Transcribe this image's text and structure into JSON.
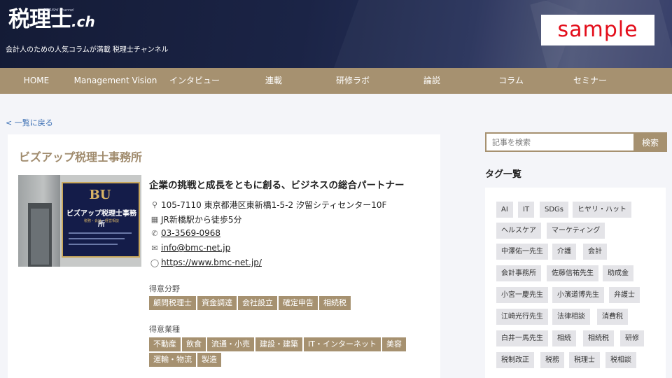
{
  "header": {
    "logo_main": "税理士",
    "logo_ch": ".ch",
    "logo_small": "ZEIRISHI Channel",
    "tagline": "会計人のための人気コラムが満載 税理士チャンネル",
    "sample": "sample",
    "colors": {
      "brand": "#a69170",
      "header_bg": "#1b2446",
      "sample_red": "#e30d1a"
    }
  },
  "nav": {
    "items": [
      {
        "label": "HOME"
      },
      {
        "label": "Management Vision"
      },
      {
        "label": "インタビュー"
      },
      {
        "label": "連載"
      },
      {
        "label": "研修ラボ"
      },
      {
        "label": "論説"
      },
      {
        "label": "コラム"
      },
      {
        "label": "セミナー"
      }
    ]
  },
  "back_link": "< 一覧に戻る",
  "office": {
    "name": "ビズアップ税理士事務所",
    "photo": {
      "sign_logo": "BU",
      "sign_name": "ビズアップ税理士事務所",
      "sign_sub": "税務・会計・経営相談"
    },
    "headline": "企業の挑戦と成長をともに創る、ビジネスの総合パートナー",
    "address": "105-7110 東京都港区東新橋1-5-2 汐留シティセンター10F",
    "access": "JR新橋駅から徒歩5分",
    "phone": "03-3569-0968",
    "email": "info@bmc-net.jp",
    "website": "https://www.bmc-net.jp/",
    "icons": {
      "address": "pin-icon",
      "access": "train-icon",
      "phone": "phone-icon",
      "email": "mail-icon",
      "website": "globe-icon"
    },
    "specialties_label": "得意分野",
    "specialties": [
      "顧問税理士",
      "資金調達",
      "会社設立",
      "確定申告",
      "相続税"
    ],
    "industries_label": "得意業種",
    "industries": [
      "不動産",
      "飲食",
      "流通・小売",
      "建設・建築",
      "IT・インターネット",
      "美容",
      "運輸・物流",
      "製造"
    ]
  },
  "sidebar": {
    "search_placeholder": "記事を検索",
    "search_button": "検索",
    "tags_heading": "タグ一覧",
    "tags": [
      "AI",
      "IT",
      "SDGs",
      "ヒヤリ・ハット",
      "ヘルスケア",
      "マーケティング",
      "中澤佑一先生",
      "介護",
      "会計",
      "会計事務所",
      "佐藤信祐先生",
      "助成金",
      "小宮一慶先生",
      "小濱道博先生",
      "弁護士",
      "江崎光行先生",
      "法律相談",
      "消費税",
      "白井一馬先生",
      "相続",
      "相続税",
      "研修",
      "税制改正",
      "税務",
      "税理士",
      "税相談"
    ]
  }
}
